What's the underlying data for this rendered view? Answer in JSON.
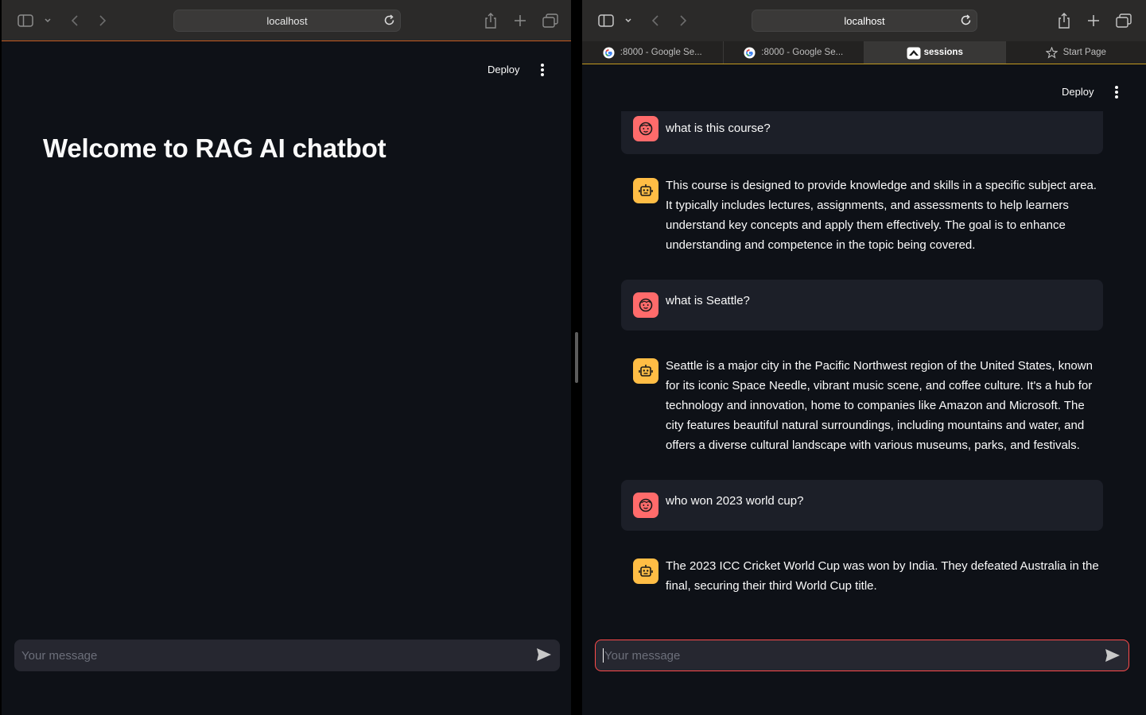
{
  "left_window": {
    "address": "localhost",
    "deploy_label": "Deploy",
    "title": "Welcome to RAG AI chatbot",
    "input_placeholder": "Your message"
  },
  "right_window": {
    "address": "localhost",
    "tabs": [
      {
        "label": ":8000 - Google Se...",
        "icon": "google-icon",
        "active": false
      },
      {
        "label": ":8000 - Google Se...",
        "icon": "google-icon",
        "active": false
      },
      {
        "label": "sessions",
        "icon": "streamlit-icon",
        "active": true
      },
      {
        "label": "Start Page",
        "icon": "star-icon",
        "active": false
      }
    ],
    "deploy_label": "Deploy",
    "messages": [
      {
        "role": "user",
        "text": "what is this course?"
      },
      {
        "role": "assistant",
        "text": "This course is designed to provide knowledge and skills in a specific subject area. It typically includes lectures, assignments, and assessments to help learners understand key concepts and apply them effectively. The goal is to enhance understanding and competence in the topic being covered."
      },
      {
        "role": "user",
        "text": "what is Seattle?"
      },
      {
        "role": "assistant",
        "text": "Seattle is a major city in the Pacific Northwest region of the United States, known for its iconic Space Needle, vibrant music scene, and coffee culture. It's a hub for technology and innovation, home to companies like Amazon and Microsoft. The city features beautiful natural surroundings, including mountains and water, and offers a diverse cultural landscape with various museums, parks, and festivals."
      },
      {
        "role": "user",
        "text": "who won 2023 world cup?"
      },
      {
        "role": "assistant",
        "text": "The 2023 ICC Cricket World Cup was won by India. They defeated Australia in the final, securing their third World Cup title."
      }
    ],
    "input_placeholder": "Your message"
  },
  "colors": {
    "app_bg": "#0e1117",
    "user_bubble": "#1c1f28",
    "user_avatar": "#ff6b6b",
    "bot_avatar": "#ffbd45",
    "input_bg": "#262730",
    "focus_border": "#ff4b4b"
  }
}
